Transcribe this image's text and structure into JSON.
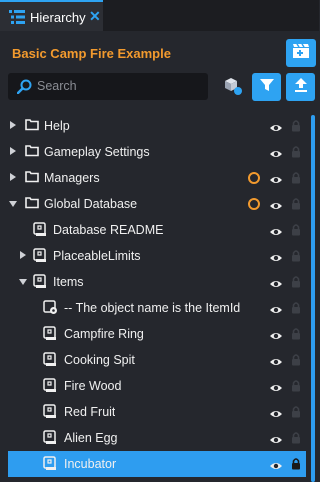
{
  "tab": {
    "label": "Hierarchy",
    "close": "✕"
  },
  "project_title": "Basic Camp Fire Example",
  "search": {
    "placeholder": "Search"
  },
  "colors": {
    "accent": "#2ea3f2",
    "title": "#f29a2e",
    "selection": "#2e9df0",
    "background": "#25272d"
  },
  "tree": [
    {
      "label": "Help",
      "icon": "folder-icon",
      "expand": "collapsed",
      "level": 0,
      "modified": false,
      "lock": "dim"
    },
    {
      "label": "Gameplay Settings",
      "icon": "folder-icon",
      "expand": "collapsed",
      "level": 0,
      "modified": false,
      "lock": "dim"
    },
    {
      "label": "Managers",
      "icon": "folder-icon",
      "expand": "collapsed",
      "level": 0,
      "modified": true,
      "lock": "dim"
    },
    {
      "label": "Global Database",
      "icon": "folder-icon",
      "expand": "expanded",
      "level": 0,
      "modified": true,
      "lock": "dim"
    },
    {
      "label": "Database README",
      "icon": "script-object-icon",
      "expand": "none",
      "level": 1,
      "modified": false,
      "lock": "dim"
    },
    {
      "label": "PlaceableLimits",
      "icon": "script-object-icon",
      "expand": "collapsed",
      "level": 1,
      "modified": false,
      "lock": "dim"
    },
    {
      "label": "Items",
      "icon": "script-object-icon",
      "expand": "expanded",
      "level": 1,
      "modified": false,
      "lock": "dim"
    },
    {
      "label": "-- The object name is the ItemId",
      "icon": "script-gear-icon",
      "expand": "none",
      "level": 2,
      "modified": false,
      "lock": "dim"
    },
    {
      "label": "Campfire Ring",
      "icon": "script-object-icon",
      "expand": "none",
      "level": 2,
      "modified": false,
      "lock": "dim"
    },
    {
      "label": "Cooking Spit",
      "icon": "script-object-icon",
      "expand": "none",
      "level": 2,
      "modified": false,
      "lock": "dim"
    },
    {
      "label": "Fire Wood",
      "icon": "script-object-icon",
      "expand": "none",
      "level": 2,
      "modified": false,
      "lock": "dim"
    },
    {
      "label": "Red Fruit",
      "icon": "script-object-icon",
      "expand": "none",
      "level": 2,
      "modified": false,
      "lock": "dim"
    },
    {
      "label": "Alien Egg",
      "icon": "script-object-icon",
      "expand": "none",
      "level": 2,
      "modified": false,
      "lock": "dim"
    },
    {
      "label": "Incubator",
      "icon": "script-object-icon",
      "expand": "none",
      "level": 2,
      "modified": false,
      "lock": "bright",
      "selected": true
    }
  ]
}
